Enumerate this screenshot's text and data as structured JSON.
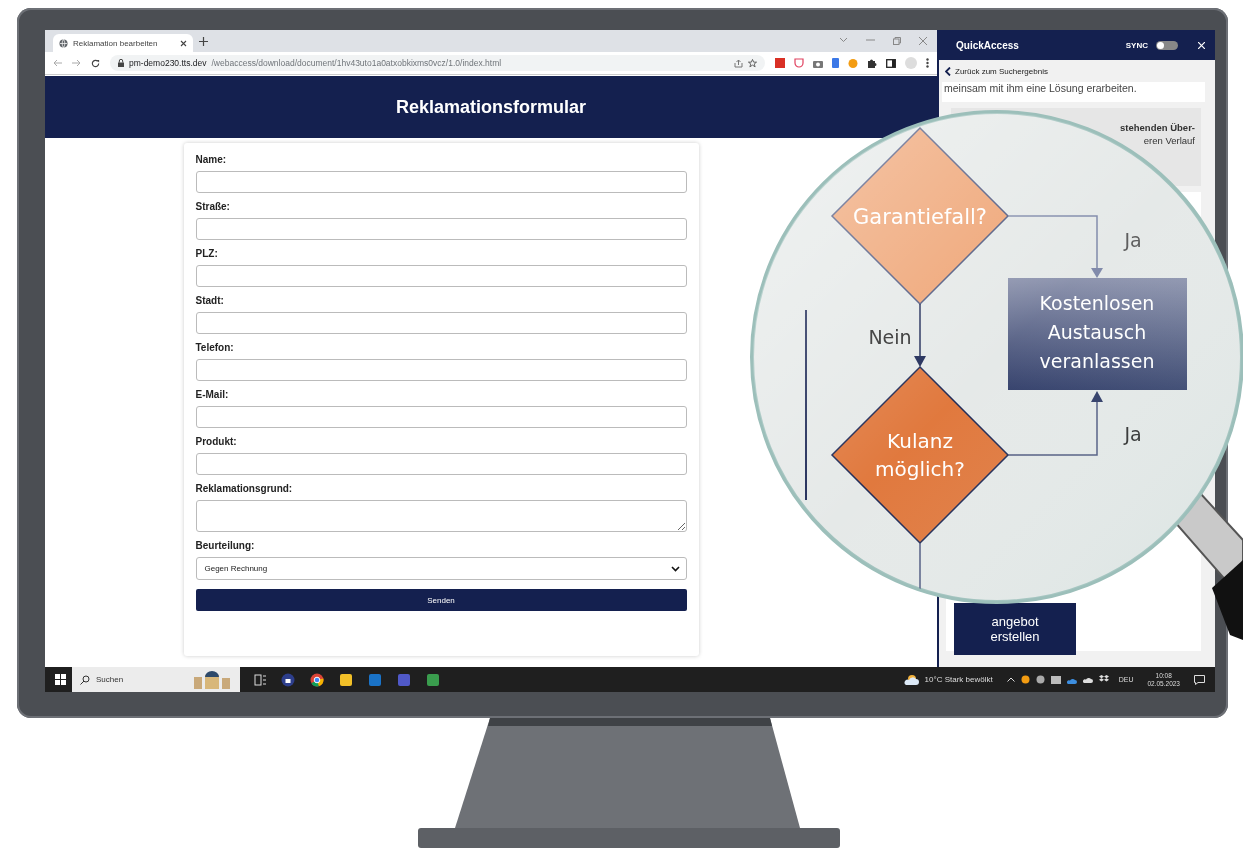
{
  "browser": {
    "tab_title": "Reklamation bearbeiten",
    "url_host": "pm-demo230.tts.dev",
    "url_path": "/webaccess/download/document/1hv43uto1a0atxobkixms0vcz/1.0/index.html"
  },
  "page": {
    "title": "Reklamationsformular",
    "fields": [
      {
        "label": "Name:",
        "kind": "text"
      },
      {
        "label": "Straße:",
        "kind": "text"
      },
      {
        "label": "PLZ:",
        "kind": "text"
      },
      {
        "label": "Stadt:",
        "kind": "text"
      },
      {
        "label": "Telefon:",
        "kind": "text"
      },
      {
        "label": "E-Mail:",
        "kind": "text"
      },
      {
        "label": "Produkt:",
        "kind": "text"
      },
      {
        "label": "Reklamationsgrund:",
        "kind": "textarea"
      },
      {
        "label": "Beurteilung:",
        "kind": "select",
        "value": "Gegen Rechnung"
      }
    ],
    "submit": "Senden"
  },
  "quickaccess": {
    "title": "QuickAccess",
    "sync_label": "SYNC",
    "sync_on": false,
    "back_link": "Zurück zum Suchergebnis",
    "text_line": "meinsam mit ihm eine Lösung erarbeiten.",
    "partial_lines": [
      "stehenden Über-",
      "eren Verlauf"
    ],
    "bottom_box": [
      "angebot",
      "erstellen"
    ]
  },
  "magnifier": {
    "decision_1": "Garantiefall?",
    "decision_2": "Kulanz möglich?",
    "action": "Kostenlosen Austausch veranlassen",
    "yes_label_1": "Ja",
    "no_label": "Nein",
    "yes_label_2": "Ja"
  },
  "taskbar": {
    "search_placeholder": "Suchen",
    "weather": "10°C  Stark bewölkt",
    "language": "DEU",
    "time": "10:08",
    "date": "02.05.2023"
  }
}
